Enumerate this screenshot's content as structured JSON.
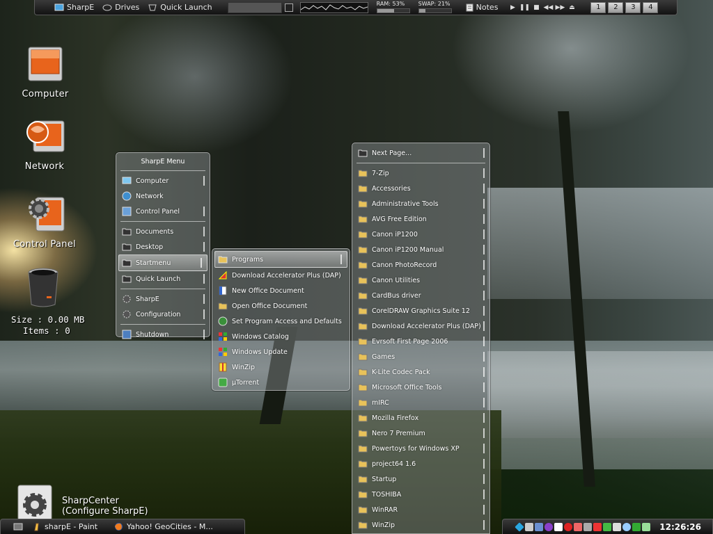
{
  "topbar": {
    "sharpe_label": "SharpE",
    "drives_label": "Drives",
    "quicklaunch_label": "Quick Launch",
    "ram_label": "RAM: 53%",
    "ram_percent": 53,
    "swap_label": "SWAP: 21%",
    "swap_percent": 21,
    "notes_label": "Notes",
    "desktops": [
      "1",
      "2",
      "3",
      "4"
    ]
  },
  "desktop": {
    "computer": "Computer",
    "network": "Network",
    "control_panel": "Control Panel",
    "recycle_size": "Size : 0.00 MB",
    "recycle_items": "Items : 0",
    "sharpcenter_line1": "SharpCenter",
    "sharpcenter_line2": "(Configure SharpE)"
  },
  "sharpe_menu": {
    "title": "SharpE Menu",
    "items": [
      "Computer",
      "Network",
      "Control Panel",
      "Documents",
      "Desktop",
      "Startmenu",
      "Quick Launch",
      "SharpE",
      "Configuration",
      "Shutdown"
    ]
  },
  "startmenu": {
    "items": [
      "Programs",
      "Download Accelerator Plus (DAP)",
      "New Office Document",
      "Open Office Document",
      "Set Program Access and Defaults",
      "Windows Catalog",
      "Windows Update",
      "WinZip",
      "µTorrent"
    ]
  },
  "programs": {
    "next_page": "Next Page...",
    "items": [
      "7-Zip",
      "Accessories",
      "Administrative Tools",
      "AVG Free Edition",
      "Canon iP1200",
      "Canon iP1200 Manual",
      "Canon PhotoRecord",
      "Canon Utilities",
      "CardBus driver",
      "CorelDRAW Graphics Suite 12",
      "Download Accelerator Plus (DAP)",
      "Evrsoft First Page 2006",
      "Games",
      "K-Lite Codec Pack",
      "Microsoft Office Tools",
      "mIRC",
      "Mozilla Firefox",
      "Nero 7 Premium",
      "Powertoys for Windows XP",
      "project64 1.6",
      "Startup",
      "TOSHIBA",
      "WinRAR",
      "WinZip"
    ]
  },
  "taskbar": {
    "task1": "sharpE - Paint",
    "task2": "Yahoo! GeoCities - M..."
  },
  "tray": {
    "clock": "12:26:26"
  }
}
